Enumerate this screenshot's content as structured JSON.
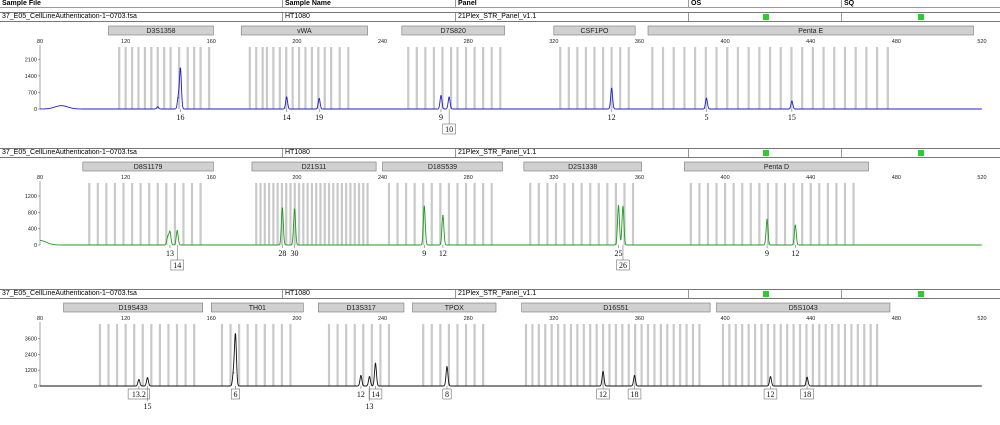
{
  "header": {
    "sample_file": "Sample File",
    "sample_name": "Sample Name",
    "panel": "Panel",
    "os": "OS",
    "sq": "SQ"
  },
  "colors": {
    "blue": "#1f1fc8",
    "green": "#1e9e1e",
    "black": "#111111",
    "bin": "#c9c9c9",
    "marker_fill": "#d0d0d0",
    "quality": "#2ecc2e"
  },
  "panels": [
    {
      "sample_file": "37_E05_CellLineAuthentication-1~0703.fsa",
      "sample_name": "HT1080",
      "panel": "21Plex_STR_Panel_v1.1",
      "dye": "blue",
      "markers": [
        {
          "name": "D3S1358",
          "start": 112,
          "end": 161
        },
        {
          "name": "vWA",
          "start": 174,
          "end": 233
        },
        {
          "name": "D7S820",
          "start": 249,
          "end": 297
        },
        {
          "name": "CSF1PO",
          "start": 320,
          "end": 358
        },
        {
          "name": "Penta E",
          "start": 364,
          "end": 516
        }
      ],
      "bins": [
        117,
        120,
        123,
        126,
        129,
        132,
        135,
        138,
        141,
        145,
        149,
        152,
        155,
        159,
        178,
        181,
        184,
        186,
        189,
        192,
        195,
        198,
        201,
        204,
        207,
        210,
        213,
        216,
        220,
        224,
        252,
        256,
        260,
        264,
        268,
        272,
        275,
        279,
        283,
        287,
        291,
        295,
        323,
        327,
        331,
        335,
        339,
        343,
        347,
        351,
        355,
        366,
        371,
        376,
        381,
        386,
        391,
        396,
        401,
        406,
        411,
        416,
        421,
        426,
        431,
        436,
        441,
        446,
        451,
        456,
        461,
        466,
        471,
        476
      ],
      "yticks": [
        0,
        700,
        1400,
        2100
      ],
      "ymax": 2450,
      "xticks": [
        80,
        120,
        160,
        200,
        240,
        280,
        320,
        360,
        400,
        440,
        480,
        520
      ],
      "baseline_bumps": [
        {
          "x": 90,
          "h": 140
        }
      ],
      "peaks": [
        {
          "x": 144.6,
          "h": 480
        },
        {
          "x": 145.6,
          "h": 1700
        },
        {
          "x": 195.2,
          "h": 500
        },
        {
          "x": 210.4,
          "h": 440
        },
        {
          "x": 267.3,
          "h": 560
        },
        {
          "x": 271.1,
          "h": 500
        },
        {
          "x": 347.0,
          "h": 860
        },
        {
          "x": 391.3,
          "h": 450
        },
        {
          "x": 431.2,
          "h": 330
        },
        {
          "x": 135.0,
          "h": 90
        }
      ],
      "alleles": [
        {
          "x": 145.6,
          "label": "16",
          "row": 0,
          "boxed": false
        },
        {
          "x": 195.2,
          "label": "14",
          "row": 0,
          "boxed": false
        },
        {
          "x": 210.4,
          "label": "19",
          "row": 0,
          "boxed": false
        },
        {
          "x": 267.3,
          "label": "9",
          "row": 0,
          "boxed": false
        },
        {
          "x": 271.1,
          "label": "10",
          "row": 1,
          "boxed": true
        },
        {
          "x": 347.0,
          "label": "12",
          "row": 0,
          "boxed": false
        },
        {
          "x": 391.3,
          "label": "5",
          "row": 0,
          "boxed": false
        },
        {
          "x": 431.2,
          "label": "15",
          "row": 0,
          "boxed": false
        }
      ]
    },
    {
      "sample_file": "37_E05_CellLineAuthentication-1~0703.fsa",
      "sample_name": "HT1080",
      "panel": "21Plex_STR_Panel_v1.1",
      "dye": "green",
      "markers": [
        {
          "name": "D8S1179",
          "start": 100,
          "end": 161
        },
        {
          "name": "D21S11",
          "start": 179,
          "end": 237
        },
        {
          "name": "D18S539",
          "start": 240,
          "end": 296
        },
        {
          "name": "D2S1338",
          "start": 306,
          "end": 361
        },
        {
          "name": "Penta D",
          "start": 381,
          "end": 467
        }
      ],
      "bins": [
        103,
        107,
        111,
        115,
        119,
        123,
        127,
        131,
        135,
        139,
        143,
        147,
        151,
        155,
        181,
        183,
        185,
        187,
        189,
        191,
        193,
        195,
        197,
        199,
        201,
        203,
        205,
        207,
        209,
        211,
        213,
        215,
        217,
        219,
        221,
        223,
        225,
        227,
        229,
        231,
        233,
        243,
        247,
        251,
        255,
        259,
        263,
        267,
        271,
        275,
        279,
        283,
        287,
        291,
        309,
        313,
        317,
        321,
        325,
        329,
        333,
        337,
        341,
        345,
        349,
        353,
        357,
        384,
        388,
        392,
        396,
        400,
        404,
        408,
        412,
        416,
        420,
        424,
        428,
        432,
        436,
        440,
        444,
        448,
        452,
        456,
        460
      ],
      "yticks": [
        0,
        400,
        800,
        1200
      ],
      "ymax": 1420,
      "xticks": [
        80,
        120,
        160,
        200,
        240,
        280,
        320,
        360,
        400,
        440,
        480,
        520
      ],
      "baseline_bumps": [
        {
          "x": 80,
          "h": 110
        }
      ],
      "peaks": [
        {
          "x": 139.7,
          "h": 200
        },
        {
          "x": 140.7,
          "h": 320
        },
        {
          "x": 144.1,
          "h": 350
        },
        {
          "x": 193.2,
          "h": 900
        },
        {
          "x": 198.9,
          "h": 880
        },
        {
          "x": 259.5,
          "h": 950
        },
        {
          "x": 268.2,
          "h": 720
        },
        {
          "x": 350.2,
          "h": 960
        },
        {
          "x": 352.3,
          "h": 940
        },
        {
          "x": 419.6,
          "h": 620
        },
        {
          "x": 432.8,
          "h": 480
        }
      ],
      "alleles": [
        {
          "x": 140.7,
          "label": "13",
          "row": 0,
          "boxed": false
        },
        {
          "x": 144.1,
          "label": "14",
          "row": 1,
          "boxed": true
        },
        {
          "x": 193.2,
          "label": "28",
          "row": 0,
          "boxed": false
        },
        {
          "x": 198.9,
          "label": "30",
          "row": 0,
          "boxed": false
        },
        {
          "x": 259.5,
          "label": "9",
          "row": 0,
          "boxed": false
        },
        {
          "x": 268.2,
          "label": "12",
          "row": 0,
          "boxed": false
        },
        {
          "x": 350.2,
          "label": "25",
          "row": 0,
          "boxed": false
        },
        {
          "x": 352.3,
          "label": "26",
          "row": 1,
          "boxed": true
        },
        {
          "x": 419.6,
          "label": "9",
          "row": 0,
          "boxed": false
        },
        {
          "x": 432.8,
          "label": "12",
          "row": 0,
          "boxed": false
        }
      ]
    },
    {
      "sample_file": "37_E05_CellLineAuthentication-1~0703.fsa",
      "sample_name": "HT1080",
      "panel": "21Plex_STR_Panel_v1.1",
      "dye": "black",
      "markers": [
        {
          "name": "D19S433",
          "start": 91,
          "end": 156
        },
        {
          "name": "TH01",
          "start": 160,
          "end": 203
        },
        {
          "name": "D13S317",
          "start": 210,
          "end": 250
        },
        {
          "name": "TPOX",
          "start": 254,
          "end": 293
        },
        {
          "name": "D16S51",
          "start": 305,
          "end": 393
        },
        {
          "name": "D5S1043",
          "start": 396,
          "end": 477
        }
      ],
      "bins": [
        108,
        112,
        116,
        120,
        124,
        128,
        132,
        136,
        140,
        144,
        148,
        152,
        165,
        169,
        173,
        177,
        181,
        185,
        189,
        193,
        197,
        215,
        219,
        223,
        227,
        231,
        235,
        239,
        243,
        259,
        263,
        267,
        271,
        275,
        279,
        283,
        287,
        307,
        310,
        313,
        316,
        319,
        322,
        325,
        328,
        331,
        334,
        337,
        340,
        343,
        346,
        349,
        352,
        355,
        358,
        361,
        364,
        367,
        370,
        373,
        376,
        379,
        382,
        385,
        388,
        399,
        402,
        405,
        408,
        411,
        414,
        417,
        420,
        423,
        426,
        429,
        432,
        435,
        438,
        441,
        444,
        447,
        450,
        453,
        456,
        459,
        462,
        465,
        468,
        471
      ],
      "yticks": [
        0,
        1200,
        2400,
        3600
      ],
      "ymax": 4400,
      "xticks": [
        80,
        120,
        160,
        200,
        240,
        280,
        320,
        360,
        400,
        440,
        480,
        520
      ],
      "baseline_bumps": [],
      "peaks": [
        {
          "x": 126.2,
          "h": 480
        },
        {
          "x": 130.2,
          "h": 620
        },
        {
          "x": 170.4,
          "h": 1000
        },
        {
          "x": 171.3,
          "h": 3850
        },
        {
          "x": 229.9,
          "h": 780
        },
        {
          "x": 233.9,
          "h": 700
        },
        {
          "x": 236.7,
          "h": 1700
        },
        {
          "x": 270.1,
          "h": 1450
        },
        {
          "x": 343.0,
          "h": 1080
        },
        {
          "x": 357.7,
          "h": 780
        },
        {
          "x": 421.2,
          "h": 700
        },
        {
          "x": 438.3,
          "h": 650
        }
      ],
      "alleles": [
        {
          "x": 126.2,
          "label": "13.2",
          "row": 0,
          "boxed": true
        },
        {
          "x": 130.2,
          "label": "15",
          "row": 1,
          "boxed": false
        },
        {
          "x": 171.3,
          "label": "6",
          "row": 0,
          "boxed": true
        },
        {
          "x": 229.9,
          "label": "12",
          "row": 0,
          "boxed": false
        },
        {
          "x": 233.9,
          "label": "13",
          "row": 1,
          "boxed": false
        },
        {
          "x": 236.7,
          "label": "14",
          "row": 0,
          "boxed": true
        },
        {
          "x": 270.1,
          "label": "8",
          "row": 0,
          "boxed": true
        },
        {
          "x": 343.0,
          "label": "12",
          "row": 0,
          "boxed": true
        },
        {
          "x": 357.7,
          "label": "18",
          "row": 0,
          "boxed": true
        },
        {
          "x": 421.2,
          "label": "12",
          "row": 0,
          "boxed": true
        },
        {
          "x": 438.3,
          "label": "18",
          "row": 0,
          "boxed": true
        }
      ]
    }
  ],
  "chart_data": [
    {
      "type": "line",
      "title": "",
      "xlabel": "",
      "ylabel": "",
      "xlim": [
        80,
        520
      ],
      "ylim": [
        0,
        2450
      ],
      "series": [
        {
          "x": [
            145.6,
            195.2,
            210.4,
            267.3,
            271.1,
            347.0,
            391.3,
            431.2
          ],
          "values": [
            1700,
            500,
            440,
            560,
            500,
            860,
            450,
            330
          ]
        }
      ],
      "markers": [
        "D3S1358",
        "vWA",
        "D7S820",
        "CSF1PO",
        "Penta E"
      ],
      "allele_calls": [
        "16",
        "14",
        "19",
        "9",
        "10",
        "12",
        "5",
        "15"
      ],
      "grid": false
    },
    {
      "type": "line",
      "title": "",
      "xlabel": "",
      "ylabel": "",
      "xlim": [
        80,
        520
      ],
      "ylim": [
        0,
        1420
      ],
      "series": [
        {
          "x": [
            140.7,
            144.1,
            193.2,
            198.9,
            259.5,
            268.2,
            350.2,
            352.3,
            419.6,
            432.8
          ],
          "values": [
            320,
            350,
            900,
            880,
            950,
            720,
            960,
            940,
            620,
            480
          ]
        }
      ],
      "markers": [
        "D8S1179",
        "D21S11",
        "D18S539",
        "D2S1338",
        "Penta D"
      ],
      "allele_calls": [
        "13",
        "14",
        "28",
        "30",
        "9",
        "12",
        "25",
        "26",
        "9",
        "12"
      ],
      "grid": false
    },
    {
      "type": "line",
      "title": "",
      "xlabel": "",
      "ylabel": "",
      "xlim": [
        80,
        520
      ],
      "ylim": [
        0,
        4400
      ],
      "series": [
        {
          "x": [
            126.2,
            130.2,
            171.3,
            229.9,
            233.9,
            236.7,
            270.1,
            343.0,
            357.7,
            421.2,
            438.3
          ],
          "values": [
            480,
            620,
            3850,
            780,
            700,
            1700,
            1450,
            1080,
            780,
            700,
            650
          ]
        }
      ],
      "markers": [
        "D19S433",
        "TH01",
        "D13S317",
        "TPOX",
        "D16S51",
        "D5S1043"
      ],
      "allele_calls": [
        "13.2",
        "15",
        "6",
        "12",
        "13",
        "14",
        "8",
        "12",
        "18",
        "12",
        "18"
      ],
      "grid": false
    }
  ]
}
